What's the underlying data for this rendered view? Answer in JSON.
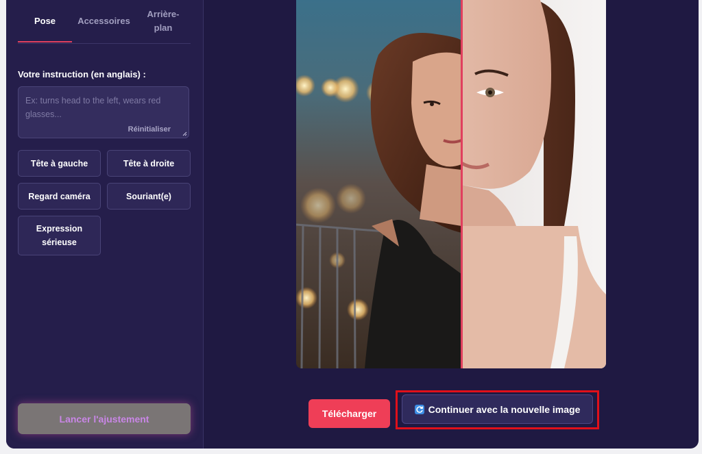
{
  "tabs": [
    {
      "label": "Pose",
      "active": true
    },
    {
      "label": "Accessoires",
      "active": false
    },
    {
      "label": "Arrière-plan",
      "active": false
    }
  ],
  "instruction": {
    "label": "Votre instruction (en anglais) :",
    "value": "",
    "placeholder": "Ex: turns head to the left, wears red glasses...",
    "reset_label": "Réinitialiser"
  },
  "presets": [
    "Tête à gauche",
    "Tête à droite",
    "Regard caméra",
    "Souriant(e)",
    "Expression sérieuse"
  ],
  "launch_label": "Lancer l'ajustement",
  "actions": {
    "download_label": "Télécharger",
    "continue_label": "Continuer avec la nouvelle image",
    "continue_icon": "refresh-icon"
  },
  "colors": {
    "accent": "#e0405e",
    "download": "#ef3e57",
    "highlight_border": "#e0101a",
    "background": "#1f1942"
  }
}
